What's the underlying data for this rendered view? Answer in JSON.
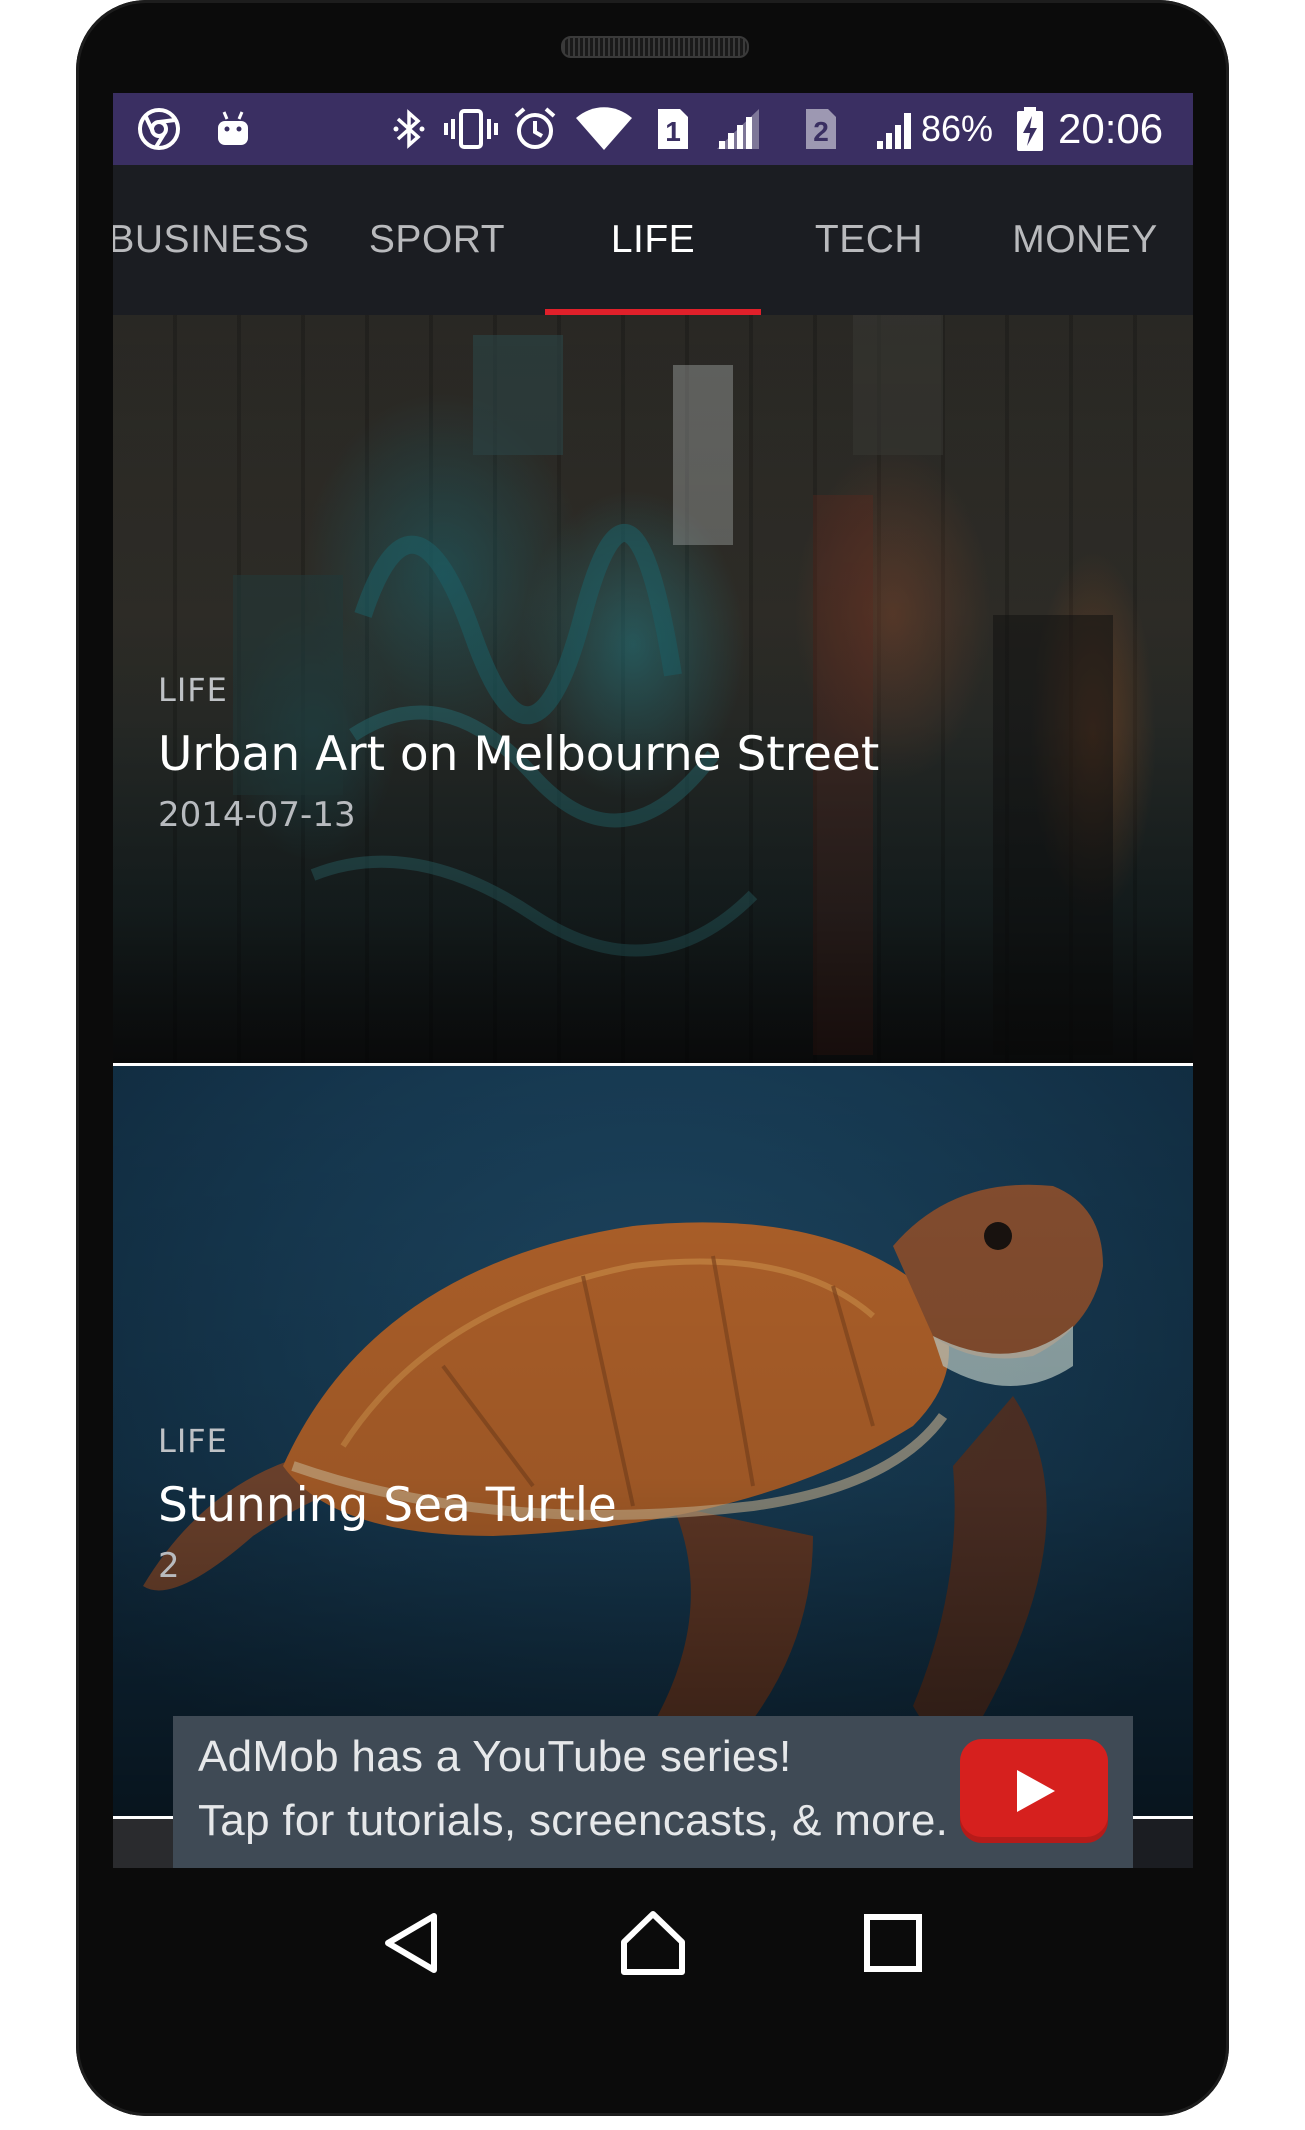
{
  "status_bar": {
    "battery": "86%",
    "time": "20:06",
    "sim1": "1",
    "sim2": "2",
    "icons": [
      "chrome-icon",
      "android-icon",
      "bluetooth-icon",
      "vibrate-icon",
      "alarm-icon",
      "wifi-icon",
      "sim1-icon",
      "signal-icon",
      "sim2-icon",
      "signal-icon",
      "battery-charging-icon"
    ]
  },
  "tabs": [
    {
      "label": "BUSINESS",
      "active": false
    },
    {
      "label": "SPORT",
      "active": false
    },
    {
      "label": "LIFE",
      "active": true
    },
    {
      "label": "TECH",
      "active": false
    },
    {
      "label": "MONEY",
      "active": false
    }
  ],
  "articles": [
    {
      "category": "LIFE",
      "title": "Urban Art on Melbourne Street",
      "date": "2014-07-13"
    },
    {
      "category": "LIFE",
      "title": "Stunning Sea Turtle",
      "date": "2"
    }
  ],
  "ad": {
    "line1": "AdMob has a YouTube series!",
    "line2": "Tap for tutorials, screencasts, & more.",
    "icon": "youtube-play-icon"
  },
  "nav": {
    "icons": [
      "back-icon",
      "home-icon",
      "recents-icon"
    ]
  },
  "colors": {
    "status_bar": "#3a2f62",
    "tab_indicator": "#e0202a",
    "ad_button": "#d6201e"
  }
}
